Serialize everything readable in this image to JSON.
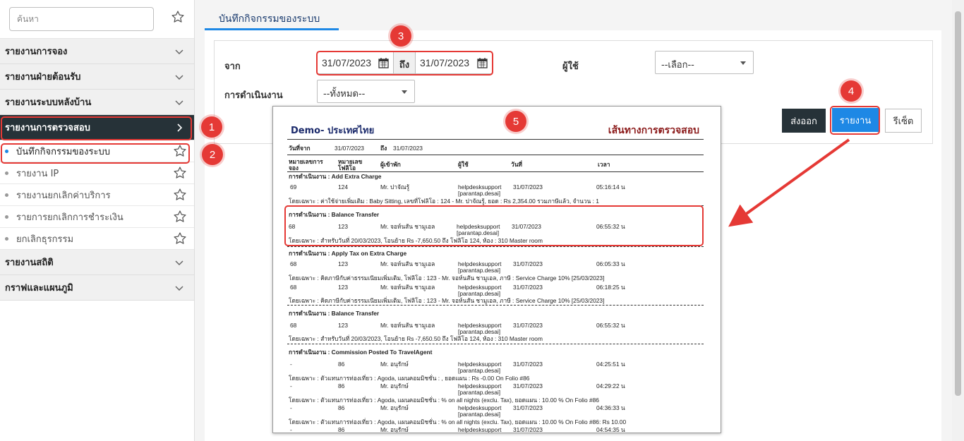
{
  "sidebar": {
    "search_placeholder": "ค้นหา",
    "sections": [
      {
        "label": "รายงานการจอง"
      },
      {
        "label": "รายงานฝ่ายต้อนรับ"
      },
      {
        "label": "รายงานระบบหลังบ้าน"
      },
      {
        "label": "รายงานการตรวจสอบ"
      },
      {
        "label": "รายงานสถิติ"
      },
      {
        "label": "กราฟและแผนภูมิ"
      }
    ],
    "audit_items": [
      {
        "label": "บันทึกกิจกรรมของระบบ"
      },
      {
        "label": "รายงาน IP"
      },
      {
        "label": "รายงานยกเลิกค่าบริการ"
      },
      {
        "label": "รายการยกเลิกการชำระเงิน"
      },
      {
        "label": "ยกเลิกธุรกรรม"
      }
    ]
  },
  "main": {
    "tab_label": "บันทึกกิจกรรมของระบบ",
    "filters": {
      "from_label": "จาก",
      "from_date": "31/07/2023",
      "to_label": "ถึง",
      "to_date": "31/07/2023",
      "user_label": "ผู้ใช้",
      "user_value": "--เลือก--",
      "operation_label": "การดำเนินงาน",
      "operation_value": "--ทั้งหมด--"
    },
    "buttons": {
      "export": "ส่งออก",
      "report": "รายงาน",
      "reset": "รีเซ็ต"
    }
  },
  "badges": [
    "1",
    "2",
    "3",
    "4",
    "5"
  ],
  "report": {
    "company": "Demo- ประเทศไทย",
    "title": "เส้นทางการตรวจสอบ",
    "date_from_label": "วันที่จาก",
    "date_from": "31/07/2023",
    "date_to_label": "ถึง",
    "date_to": "31/07/2023",
    "col_booking": "หมายเลขการ",
    "col_booking2": "จอง",
    "col_folio": "หมายเลข",
    "col_folio2": "โฟลิโอ",
    "col_guest": "ผู้เข้าพัก",
    "col_user": "ผู้ใช้",
    "col_date": "วันที่",
    "col_time": "เวลา",
    "op1": "การดำเนินงาน : Add Extra Charge",
    "r1": {
      "booking": "69",
      "folio": "124",
      "guest": "Mr. ปาจัณรู้",
      "user": "helpdesksupport",
      "user2": "[parantap.desai]",
      "date": "31/07/2023",
      "time": "05:16:14 น"
    },
    "d1": "โดยเฉพาะ : ค่าใช้จ่ายเพิ่มเติม : Baby Sitting, เลขที่โฟลิโอ : 124 - Mr. ปาจัณรู้, ยอด : Rs 2,354.00 รวมภาษีแล้ว, จำนวน : 1",
    "op2": "การดำเนินงาน : Balance Transfer",
    "r2": {
      "booking": "68",
      "folio": "123",
      "guest": "Mr. จอห์นสัน ชามูเอล",
      "user": "helpdesksupport",
      "user2": "[parantap.desai]",
      "date": "31/07/2023",
      "time": "06:55:32 น"
    },
    "d2": "โดยเฉพาะ : สำหรับวันที่ 20/03/2023, โอนย้าย Rs -7,650.50 ถึง โฟลิโอ 124, ห้อง : 310 Master room",
    "op3": "การดำเนินงาน : Apply Tax on Extra Charge",
    "r3": {
      "booking": "68",
      "folio": "123",
      "guest": "Mr. จอห์นสัน ชามูเอล",
      "user": "helpdesksupport",
      "user2": "[parantap.desai]",
      "date": "31/07/2023",
      "time": "06:05:33 น"
    },
    "d3": "โดยเฉพาะ : คิดภาษีกับค่าธรรมเนียมเพิ่มเติม, โฟลิโอ : 123 - Mr. จอห์นสัน ชามูเอล, ภาษี : Service Charge 10% [25/03/2023]",
    "r4": {
      "booking": "68",
      "folio": "123",
      "guest": "Mr. จอห์นสัน ชามูเอล",
      "user": "helpdesksupport",
      "user2": "[parantap.desai]",
      "date": "31/07/2023",
      "time": "06:18:25 น"
    },
    "d4": "โดยเฉพาะ : คิดภาษีกับค่าธรรมเนียมเพิ่มเติม, โฟลิโอ : 123 - Mr. จอห์นสัน ชามูเอล, ภาษี : Service Charge 10% [25/03/2023]",
    "op4": "การดำเนินงาน : Balance Transfer",
    "r5": {
      "booking": "68",
      "folio": "123",
      "guest": "Mr. จอห์นสัน ชามูเอล",
      "user": "helpdesksupport",
      "user2": "[parantap.desai]",
      "date": "31/07/2023",
      "time": "06:55:32 น"
    },
    "d5": "โดยเฉพาะ : สำหรับวันที่ 20/03/2023, โอนย้าย Rs -7,650.50 ถึง โฟลิโอ 124, ห้อง : 310 Master room",
    "op5": "การดำเนินงาน : Commission Posted To TravelAgent",
    "r6": {
      "booking": "-",
      "folio": "86",
      "guest": "Mr. อนุรักษ์",
      "user": "helpdesksupport",
      "user2": "[parantap.desai]",
      "date": "31/07/2023",
      "time": "04:25:51 น"
    },
    "d6": "โดยเฉพาะ : ตัวแทนการท่องเที่ยว : Agoda, แผนคอมมิชชั่น : , ยอดแผน : Rs -0.00 On Folio #86",
    "r7": {
      "booking": "-",
      "folio": "86",
      "guest": "Mr. อนุรักษ์",
      "user": "helpdesksupport",
      "user2": "[parantap.desai]",
      "date": "31/07/2023",
      "time": "04:29:22 น"
    },
    "d7": "โดยเฉพาะ : ตัวแทนการท่องเที่ยว : Agoda, แผนคอมมิชชั่น : % on all nights (exclu. Tax), ยอดแผน : 10.00 % On Folio #86",
    "r8": {
      "booking": "-",
      "folio": "86",
      "guest": "Mr. อนุรักษ์",
      "user": "helpdesksupport",
      "user2": "[parantap.desai]",
      "date": "31/07/2023",
      "time": "04:36:33 น"
    },
    "d8": "โดยเฉพาะ : ตัวแทนการท่องเที่ยว : Agoda, แผนคอมมิชชั่น : % on all nights (exclu. Tax), ยอดแผน : 10.00 % On Folio #86: Rs 10.00",
    "r9": {
      "booking": "-",
      "folio": "86",
      "guest": "Mr. อนุรักษ์",
      "user": "helpdesksupport",
      "date": "31/07/2023",
      "time": "04:54:35 น"
    }
  }
}
